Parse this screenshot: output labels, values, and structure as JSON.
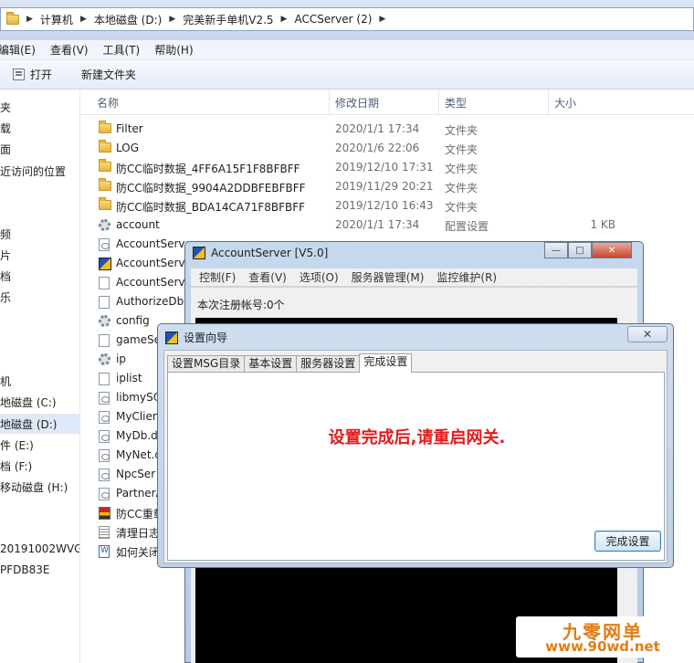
{
  "address": {
    "crumbs": [
      "计算机",
      "本地磁盘 (D:)",
      "完美新手单机V2.5",
      "ACCServer (2)"
    ]
  },
  "menubar": {
    "items": [
      "编辑(E)",
      "查看(V)",
      "工具(T)",
      "帮助(H)"
    ]
  },
  "toolbar": {
    "open_label": "打开",
    "new_folder_label": "新建文件夹"
  },
  "nav": {
    "items": [
      "夹",
      "载",
      "面",
      "近访问的位置",
      "频",
      "片",
      "档",
      "乐",
      "机",
      "地磁盘 (C:)",
      "地磁盘 (D:)",
      "件 (E:)",
      "档 (F:)",
      "移动磁盘 (H:)",
      "20191002WVG",
      "PFDB83E"
    ]
  },
  "columns": {
    "name": "名称",
    "date": "修改日期",
    "type": "类型",
    "size": "大小"
  },
  "files": [
    {
      "name": "Filter",
      "date": "2020/1/1 17:34",
      "type": "文件夹",
      "size": "",
      "icon": "folder-icon"
    },
    {
      "name": "LOG",
      "date": "2020/1/6 22:06",
      "type": "文件夹",
      "size": "",
      "icon": "folder-icon"
    },
    {
      "name": "防CC临时数据_4FF6A15F1F8BFBFF",
      "date": "2019/12/10 17:31",
      "type": "文件夹",
      "size": "",
      "icon": "folder-icon"
    },
    {
      "name": "防CC临时数据_9904A2DDBFEBFBFF",
      "date": "2019/11/29 20:21",
      "type": "文件夹",
      "size": "",
      "icon": "folder-icon"
    },
    {
      "name": "防CC临时数据_BDA14CA71F8BFBFF",
      "date": "2019/12/10 16:43",
      "type": "文件夹",
      "size": "",
      "icon": "folder-icon"
    },
    {
      "name": "account",
      "date": "2020/1/1 17:34",
      "type": "配置设置",
      "size": "1 KB",
      "icon": "config-icon"
    },
    {
      "name": "AccountServer",
      "date": "",
      "type": "",
      "size": "",
      "icon": "dll-icon"
    },
    {
      "name": "AccountServer",
      "date": "",
      "type": "",
      "size": "",
      "icon": "app-icon"
    },
    {
      "name": "AccountServer",
      "date": "",
      "type": "",
      "size": "",
      "icon": "file-icon"
    },
    {
      "name": "AuthorizeDb.",
      "date": "",
      "type": "",
      "size": "",
      "icon": "file-icon"
    },
    {
      "name": "config",
      "date": "",
      "type": "",
      "size": "",
      "icon": "config-icon"
    },
    {
      "name": "gameSe",
      "date": "",
      "type": "",
      "size": "",
      "icon": "file-icon"
    },
    {
      "name": "ip",
      "date": "",
      "type": "",
      "size": "",
      "icon": "config-icon"
    },
    {
      "name": "iplist",
      "date": "",
      "type": "",
      "size": "",
      "icon": "file-icon"
    },
    {
      "name": "libmySQ",
      "date": "",
      "type": "",
      "size": "",
      "icon": "dll-icon"
    },
    {
      "name": "MyClien",
      "date": "",
      "type": "",
      "size": "",
      "icon": "dll-icon"
    },
    {
      "name": "MyDb.d",
      "date": "",
      "type": "",
      "size": "",
      "icon": "dll-icon"
    },
    {
      "name": "MyNet.d",
      "date": "",
      "type": "",
      "size": "",
      "icon": "dll-icon"
    },
    {
      "name": "NpcSer",
      "date": "",
      "type": "",
      "size": "",
      "icon": "dll-icon"
    },
    {
      "name": "PartnerA",
      "date": "",
      "type": "",
      "size": "",
      "icon": "dll-icon"
    },
    {
      "name": "防CC重载",
      "date": "",
      "type": "",
      "size": "",
      "icon": "bat-icon"
    },
    {
      "name": "清理日志",
      "date": "",
      "type": "",
      "size": "",
      "icon": "txt-icon"
    },
    {
      "name": "如何关闭",
      "date": "",
      "type": "",
      "size": "",
      "icon": "doc-icon"
    }
  ],
  "account_window": {
    "title": "AccountServer [V5.0]",
    "menu": [
      "控制(F)",
      "查看(V)",
      "选项(O)",
      "服务器管理(M)",
      "监控维护(R)"
    ],
    "count_label": "本次注册帐号:0个"
  },
  "wizard": {
    "title": "设置向导",
    "tabs": [
      "设置MSG目录",
      "基本设置",
      "服务器设置",
      "完成设置"
    ],
    "active_tab": 3,
    "message": "设置完成后,请重启网关.",
    "finish_button": "完成设置"
  },
  "watermark": {
    "line1": "九零网单",
    "line2": "www.90wd.net"
  }
}
